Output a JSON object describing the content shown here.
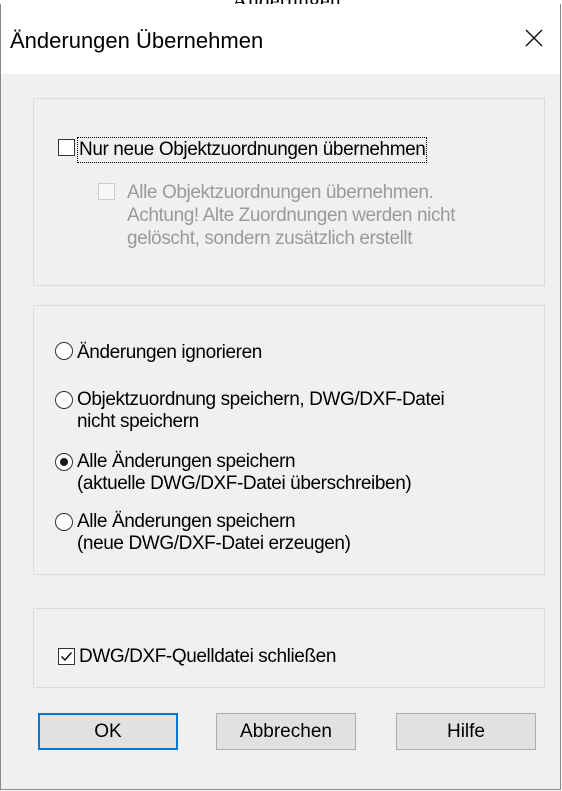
{
  "top_fragment": "Änderungen",
  "dialog": {
    "title": "Änderungen Übernehmen",
    "close_icon": "close-icon"
  },
  "group1": {
    "only_new_mappings": {
      "label": "Nur neue Objektzuordnungen übernehmen",
      "checked": false
    },
    "all_mappings": {
      "label": "Alle Objektzuordnungen übernehmen.\nAchtung! Alte Zuordnungen werden nicht\ngelöscht, sondern zusätzlich erstellt",
      "checked": false,
      "enabled": false
    }
  },
  "group2": {
    "options": [
      {
        "label": "Änderungen ignorieren",
        "selected": false
      },
      {
        "label": "Objektzuordnung speichern, DWG/DXF-Datei\nnicht speichern",
        "selected": false
      },
      {
        "label": "Alle Änderungen speichern\n(aktuelle DWG/DXF-Datei überschreiben)",
        "selected": true
      },
      {
        "label": "Alle Änderungen speichern\n(neue DWG/DXF-Datei erzeugen)",
        "selected": false
      }
    ]
  },
  "group3": {
    "close_source": {
      "label": "DWG/DXF-Quelldatei schließen",
      "checked": true
    }
  },
  "buttons": {
    "ok": "OK",
    "cancel": "Abbrechen",
    "help": "Hilfe"
  }
}
